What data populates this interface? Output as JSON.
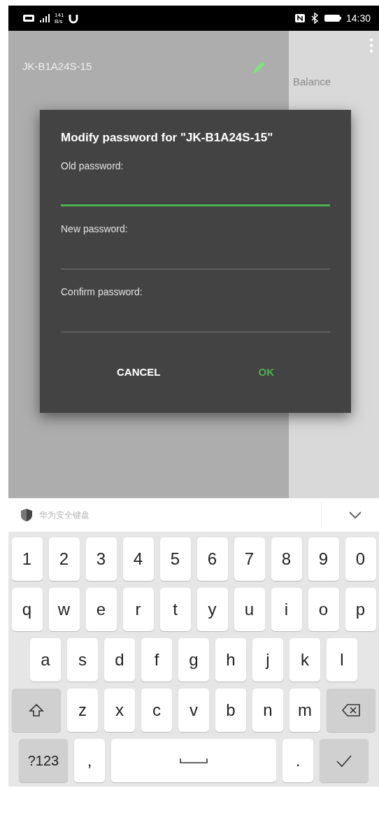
{
  "status_bar": {
    "net_speed": "141",
    "net_unit": "B/s",
    "time": "14:30"
  },
  "app": {
    "device_name": "JK-B1A24S-15",
    "side_label": "Balance"
  },
  "dialog": {
    "title": "Modify password for \"JK-B1A24S-15\"",
    "fields": [
      {
        "label": "Old password:",
        "focused": true
      },
      {
        "label": "New password:",
        "focused": false
      },
      {
        "label": "Confirm password:",
        "focused": false
      }
    ],
    "buttons": [
      {
        "label": "CANCEL",
        "kind": "neutral"
      },
      {
        "label": "OK",
        "kind": "positive"
      }
    ]
  },
  "keyboard": {
    "title": "华为安全键盘",
    "rows": [
      [
        {
          "kind": "char",
          "label": "1"
        },
        {
          "kind": "char",
          "label": "2"
        },
        {
          "kind": "char",
          "label": "3"
        },
        {
          "kind": "char",
          "label": "4"
        },
        {
          "kind": "char",
          "label": "5"
        },
        {
          "kind": "char",
          "label": "6"
        },
        {
          "kind": "char",
          "label": "7"
        },
        {
          "kind": "char",
          "label": "8"
        },
        {
          "kind": "char",
          "label": "9"
        },
        {
          "kind": "char",
          "label": "0"
        }
      ],
      [
        {
          "kind": "char",
          "label": "q"
        },
        {
          "kind": "char",
          "label": "w"
        },
        {
          "kind": "char",
          "label": "e"
        },
        {
          "kind": "char",
          "label": "r"
        },
        {
          "kind": "char",
          "label": "t"
        },
        {
          "kind": "char",
          "label": "y"
        },
        {
          "kind": "char",
          "label": "u"
        },
        {
          "kind": "char",
          "label": "i"
        },
        {
          "kind": "char",
          "label": "o"
        },
        {
          "kind": "char",
          "label": "p"
        }
      ],
      [
        {
          "kind": "char",
          "label": "a"
        },
        {
          "kind": "char",
          "label": "s"
        },
        {
          "kind": "char",
          "label": "d"
        },
        {
          "kind": "char",
          "label": "f"
        },
        {
          "kind": "char",
          "label": "g"
        },
        {
          "kind": "char",
          "label": "h"
        },
        {
          "kind": "char",
          "label": "j"
        },
        {
          "kind": "char",
          "label": "k"
        },
        {
          "kind": "char",
          "label": "l"
        }
      ],
      [
        {
          "kind": "shift"
        },
        {
          "kind": "char",
          "label": "z"
        },
        {
          "kind": "char",
          "label": "x"
        },
        {
          "kind": "char",
          "label": "c"
        },
        {
          "kind": "char",
          "label": "v"
        },
        {
          "kind": "char",
          "label": "b"
        },
        {
          "kind": "char",
          "label": "n"
        },
        {
          "kind": "char",
          "label": "m"
        },
        {
          "kind": "backspace"
        }
      ],
      [
        {
          "kind": "symbols",
          "label": "?123"
        },
        {
          "kind": "char",
          "label": ","
        },
        {
          "kind": "space"
        },
        {
          "kind": "char",
          "label": "."
        },
        {
          "kind": "enter"
        }
      ]
    ]
  }
}
